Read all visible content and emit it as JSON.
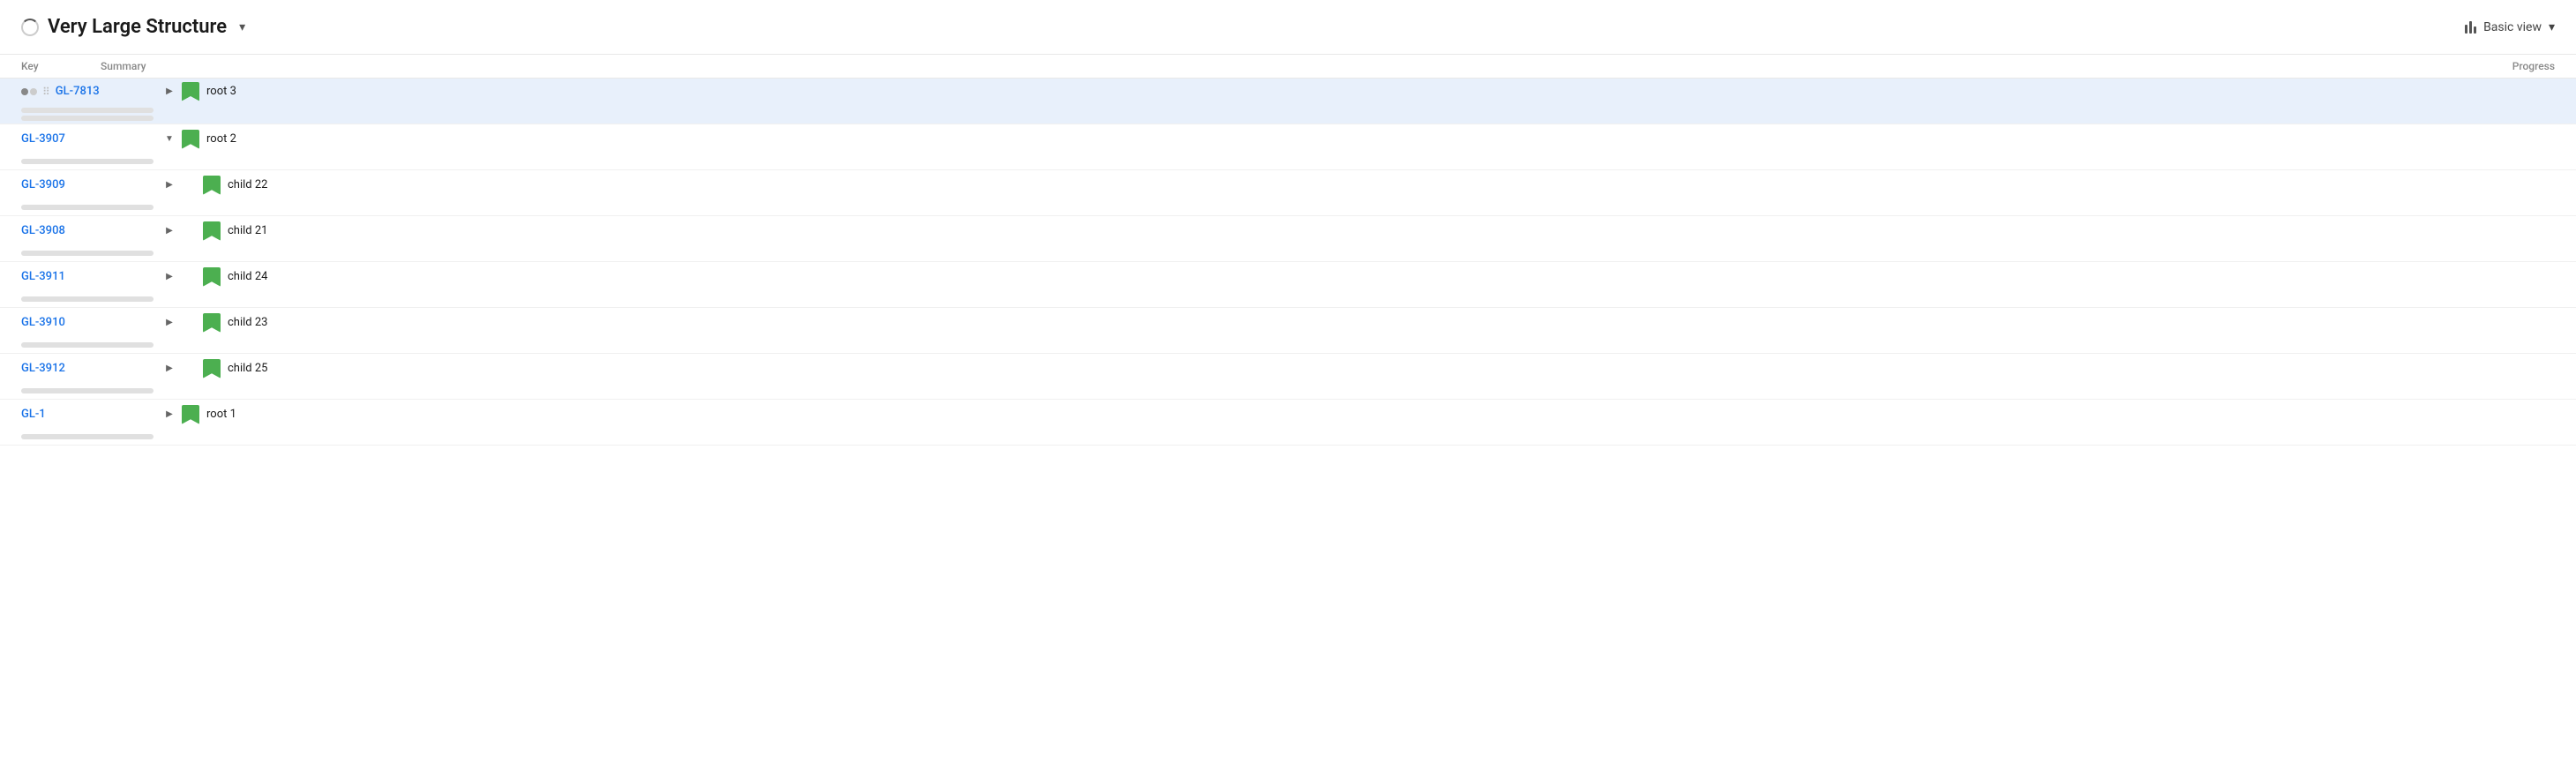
{
  "header": {
    "title": "Very Large Structure",
    "chevron": "▾",
    "view_label": "Basic view",
    "view_chevron": "▾"
  },
  "table": {
    "columns": [
      "Key",
      "Summary",
      "",
      "Progress"
    ],
    "rows": [
      {
        "id": "row-gl7813",
        "key": "GL-7813",
        "expand_state": "collapsed",
        "indent": 0,
        "summary": "root 3",
        "highlighted": true,
        "has_status": true,
        "has_drag": true,
        "progress_bars": [
          1,
          2
        ]
      },
      {
        "id": "row-gl3907",
        "key": "GL-3907",
        "expand_state": "expanded",
        "indent": 0,
        "summary": "root 2",
        "highlighted": false,
        "has_status": false,
        "has_drag": false,
        "progress_bars": [
          1
        ]
      },
      {
        "id": "row-gl3909",
        "key": "GL-3909",
        "expand_state": "collapsed",
        "indent": 1,
        "summary": "child 22",
        "highlighted": false,
        "has_status": false,
        "has_drag": false,
        "progress_bars": [
          1
        ]
      },
      {
        "id": "row-gl3908",
        "key": "GL-3908",
        "expand_state": "collapsed",
        "indent": 1,
        "summary": "child 21",
        "highlighted": false,
        "has_status": false,
        "has_drag": false,
        "progress_bars": [
          1
        ]
      },
      {
        "id": "row-gl3911",
        "key": "GL-3911",
        "expand_state": "collapsed",
        "indent": 1,
        "summary": "child 24",
        "highlighted": false,
        "has_status": false,
        "has_drag": false,
        "progress_bars": [
          1
        ]
      },
      {
        "id": "row-gl3910",
        "key": "GL-3910",
        "expand_state": "collapsed",
        "indent": 1,
        "summary": "child 23",
        "highlighted": false,
        "has_status": false,
        "has_drag": false,
        "progress_bars": [
          1
        ]
      },
      {
        "id": "row-gl3912",
        "key": "GL-3912",
        "expand_state": "collapsed",
        "indent": 1,
        "summary": "child 25",
        "highlighted": false,
        "has_status": false,
        "has_drag": false,
        "progress_bars": [
          1
        ]
      },
      {
        "id": "row-gl1",
        "key": "GL-1",
        "expand_state": "collapsed",
        "indent": 0,
        "summary": "root 1",
        "highlighted": false,
        "has_status": false,
        "has_drag": false,
        "progress_bars": [
          1
        ]
      }
    ]
  }
}
